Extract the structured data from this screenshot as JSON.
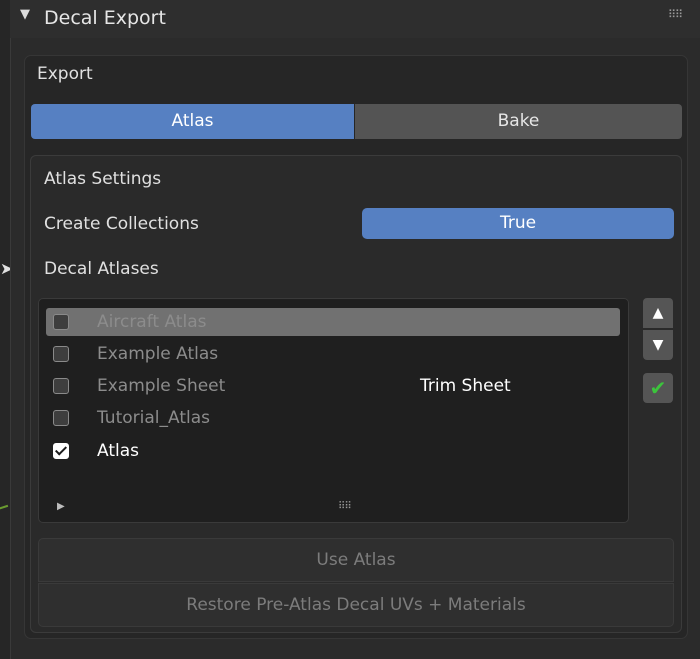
{
  "panel": {
    "title": "Decal Export",
    "grip_icon": "drag-grip-icon"
  },
  "export": {
    "label": "Export",
    "tabs": [
      {
        "label": "Atlas",
        "active": true
      },
      {
        "label": "Bake",
        "active": false
      }
    ]
  },
  "atlas_settings": {
    "label": "Atlas Settings",
    "create_collections": {
      "label": "Create Collections",
      "value": "True"
    },
    "decal_atlases_label": "Decal Atlases"
  },
  "atlas_list": {
    "rows": [
      {
        "name": "Aircraft Atlas",
        "checked": false,
        "type": "",
        "selected": true
      },
      {
        "name": "Example Atlas",
        "checked": false,
        "type": ""
      },
      {
        "name": "Example Sheet",
        "checked": false,
        "type": "Trim Sheet"
      },
      {
        "name": "Tutorial_Atlas",
        "checked": false,
        "type": ""
      },
      {
        "name": "Atlas",
        "checked": true,
        "type": ""
      }
    ]
  },
  "side_buttons": {
    "up_icon": "move-up-icon",
    "down_icon": "move-down-icon",
    "confirm_icon": "checkmark-icon"
  },
  "actions": {
    "use_atlas": "Use Atlas",
    "restore": "Restore Pre-Atlas Decal UVs + Materials"
  },
  "colors": {
    "accent": "#5680c2",
    "panel_bg": "#2b2b2b",
    "confirm_green": "#3cc43c"
  }
}
